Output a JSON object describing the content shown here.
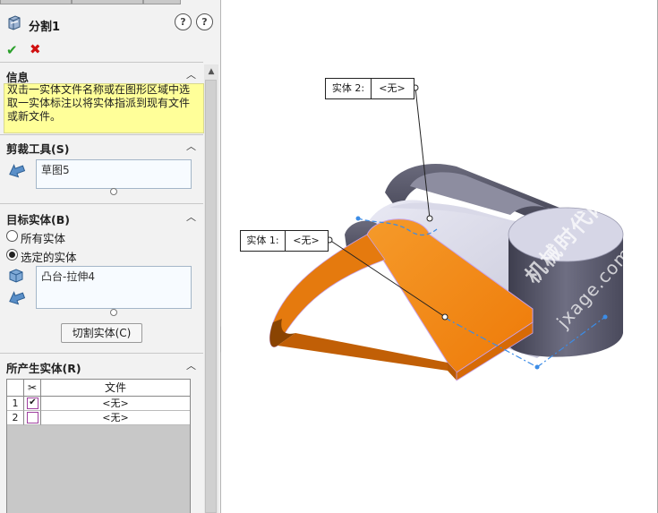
{
  "feature": {
    "title": "分割1",
    "help_label": "?",
    "ok_label": "✔",
    "cancel_label": "✖"
  },
  "groups": {
    "info": {
      "title": "信息",
      "text": "双击一实体文件名称或在图形区域中选取一实体标注以将实体指派到现有文件或新文件。"
    },
    "trim_tools": {
      "title": "剪裁工具(S)",
      "value": "草图5"
    },
    "target_bodies": {
      "title": "目标实体(B)",
      "option_all": "所有实体",
      "option_selected": "选定的实体",
      "selected_option": "选定的实体",
      "value": "凸台-拉伸4",
      "cut_button": "切割实体(C)"
    },
    "resulting_bodies": {
      "title": "所产生实体(R)",
      "column_icon": "scissors-icon",
      "column_file": "文件",
      "rows": [
        {
          "num": "1",
          "checked": true,
          "file": "<无>"
        },
        {
          "num": "2",
          "checked": false,
          "file": "<无>"
        }
      ]
    }
  },
  "viewport": {
    "callout_body2": {
      "key": "实体 2:",
      "value": "<无>"
    },
    "callout_body1": {
      "key": "实体 1:",
      "value": "<无>"
    },
    "watermark_line1": "机械时代网",
    "watermark_line2": "jxage.com"
  },
  "colors": {
    "selected_body": "#f07c0c",
    "solid_body": "#c9c9d8",
    "sketch_line": "#3c8ce6",
    "info_background": "#ffff99"
  }
}
